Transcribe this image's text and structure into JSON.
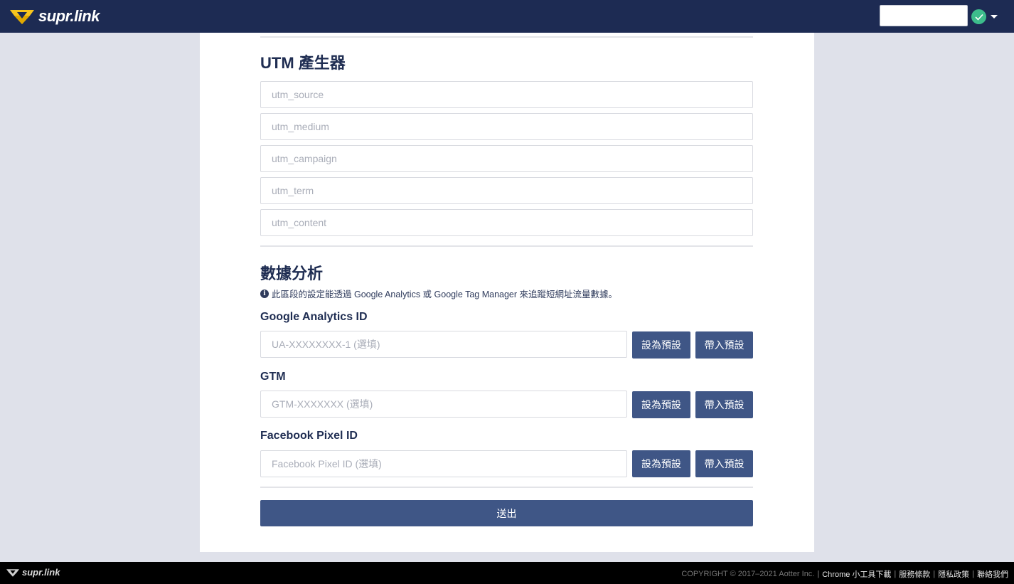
{
  "navbar": {
    "logo_text": "supr.link",
    "search_value": ""
  },
  "utm": {
    "title": "UTM 產生器",
    "fields": [
      {
        "placeholder": "utm_source"
      },
      {
        "placeholder": "utm_medium"
      },
      {
        "placeholder": "utm_campaign"
      },
      {
        "placeholder": "utm_term"
      },
      {
        "placeholder": "utm_content"
      }
    ]
  },
  "analytics": {
    "title": "數據分析",
    "note": "此區段的設定能透過 Google Analytics 或 Google Tag Manager 來追蹤短網址流量數據。",
    "ga": {
      "label": "Google Analytics ID",
      "placeholder": "UA-XXXXXXXX-1 (選填)"
    },
    "gtm": {
      "label": "GTM",
      "placeholder": "GTM-XXXXXXX (選填)"
    },
    "fb": {
      "label": "Facebook Pixel ID",
      "placeholder": "Facebook Pixel ID (選填)"
    },
    "set_default_label": "設為預設",
    "load_default_label": "帶入預設"
  },
  "submit_label": "送出",
  "footer": {
    "logo_text": "supr.link",
    "copyright": "COPYRIGHT © 2017–2021 Aotter Inc.",
    "links": [
      "Chrome 小工具下載",
      "服務條款",
      "隱私政策",
      "聯絡我們"
    ]
  },
  "colors": {
    "navbar": "#1d2b53",
    "accent": "#3f5686",
    "logo_yellow": "#f7c51e",
    "user_badge": "#3dbd8c"
  }
}
